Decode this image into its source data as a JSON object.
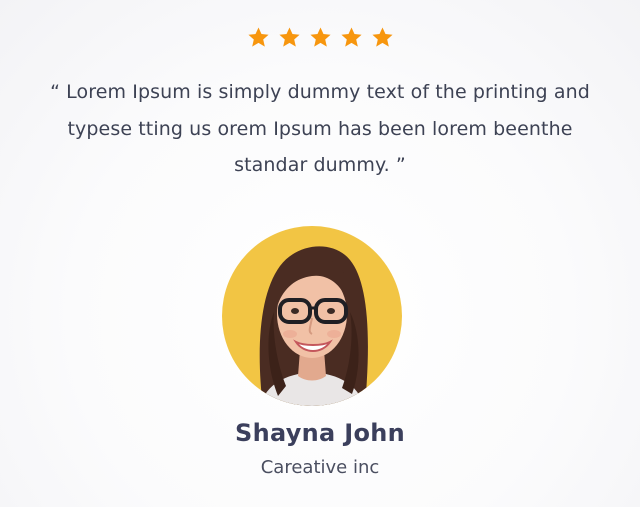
{
  "testimonial": {
    "rating": 5,
    "rating_max": 5,
    "star_icon": "star-icon",
    "star_color": "#f7960e",
    "quote": "“ Lorem Ipsum is simply dummy text of the printing and typese tting us orem Ipsum has been lorem beenthe standar dummy. ”",
    "avatar_icon": "avatar",
    "avatar_bg_color": "#f2c544",
    "author_name": "Shayna John",
    "author_company": "Careative inc",
    "text_color": "#3d4254"
  }
}
